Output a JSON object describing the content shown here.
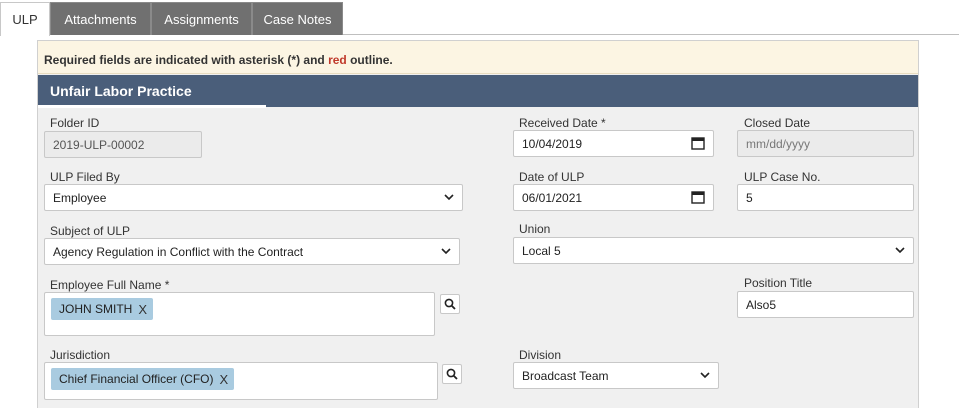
{
  "tabs": [
    {
      "label": "ULP",
      "active": true
    },
    {
      "label": "Attachments",
      "active": false
    },
    {
      "label": "Assignments",
      "active": false
    },
    {
      "label": "Case Notes",
      "active": false
    }
  ],
  "notice": {
    "prefix": "Required fields are indicated with asterisk (*) and ",
    "red_word": "red",
    "suffix": " outline."
  },
  "section": {
    "title": "Unfair Labor Practice"
  },
  "form": {
    "folder_id": {
      "label": "Folder ID",
      "value": "2019-ULP-00002"
    },
    "received_date": {
      "label": "Received Date *",
      "value": "10/04/2019"
    },
    "closed_date": {
      "label": "Closed Date",
      "placeholder": "mm/dd/yyyy"
    },
    "ulp_filed_by": {
      "label": "ULP Filed By",
      "value": "Employee"
    },
    "date_of_ulp": {
      "label": "Date of ULP",
      "value": "06/01/2021"
    },
    "ulp_case_no": {
      "label": "ULP Case No.",
      "value": "5"
    },
    "subject_of_ulp": {
      "label": "Subject of ULP",
      "value": "Agency Regulation in Conflict with the Contract"
    },
    "union": {
      "label": "Union",
      "value": "Local 5"
    },
    "employee_full_name": {
      "label": "Employee Full Name *",
      "tag": "JOHN SMITH",
      "remove": "X"
    },
    "position_title": {
      "label": "Position Title",
      "value": "Also5"
    },
    "jurisdiction": {
      "label": "Jurisdiction",
      "tag": "Chief Financial Officer (CFO)",
      "remove": "X"
    },
    "division": {
      "label": "Division",
      "value": "Broadcast Team"
    }
  },
  "colors": {
    "header": "#4a5e7a",
    "notice_bg": "#fcf5e3",
    "tag_bg": "#a9cbe0",
    "tab_inactive": "#707070"
  },
  "icons": {
    "calendar": "calendar-icon",
    "dropdown": "chevron-down-icon",
    "search": "search-icon"
  }
}
